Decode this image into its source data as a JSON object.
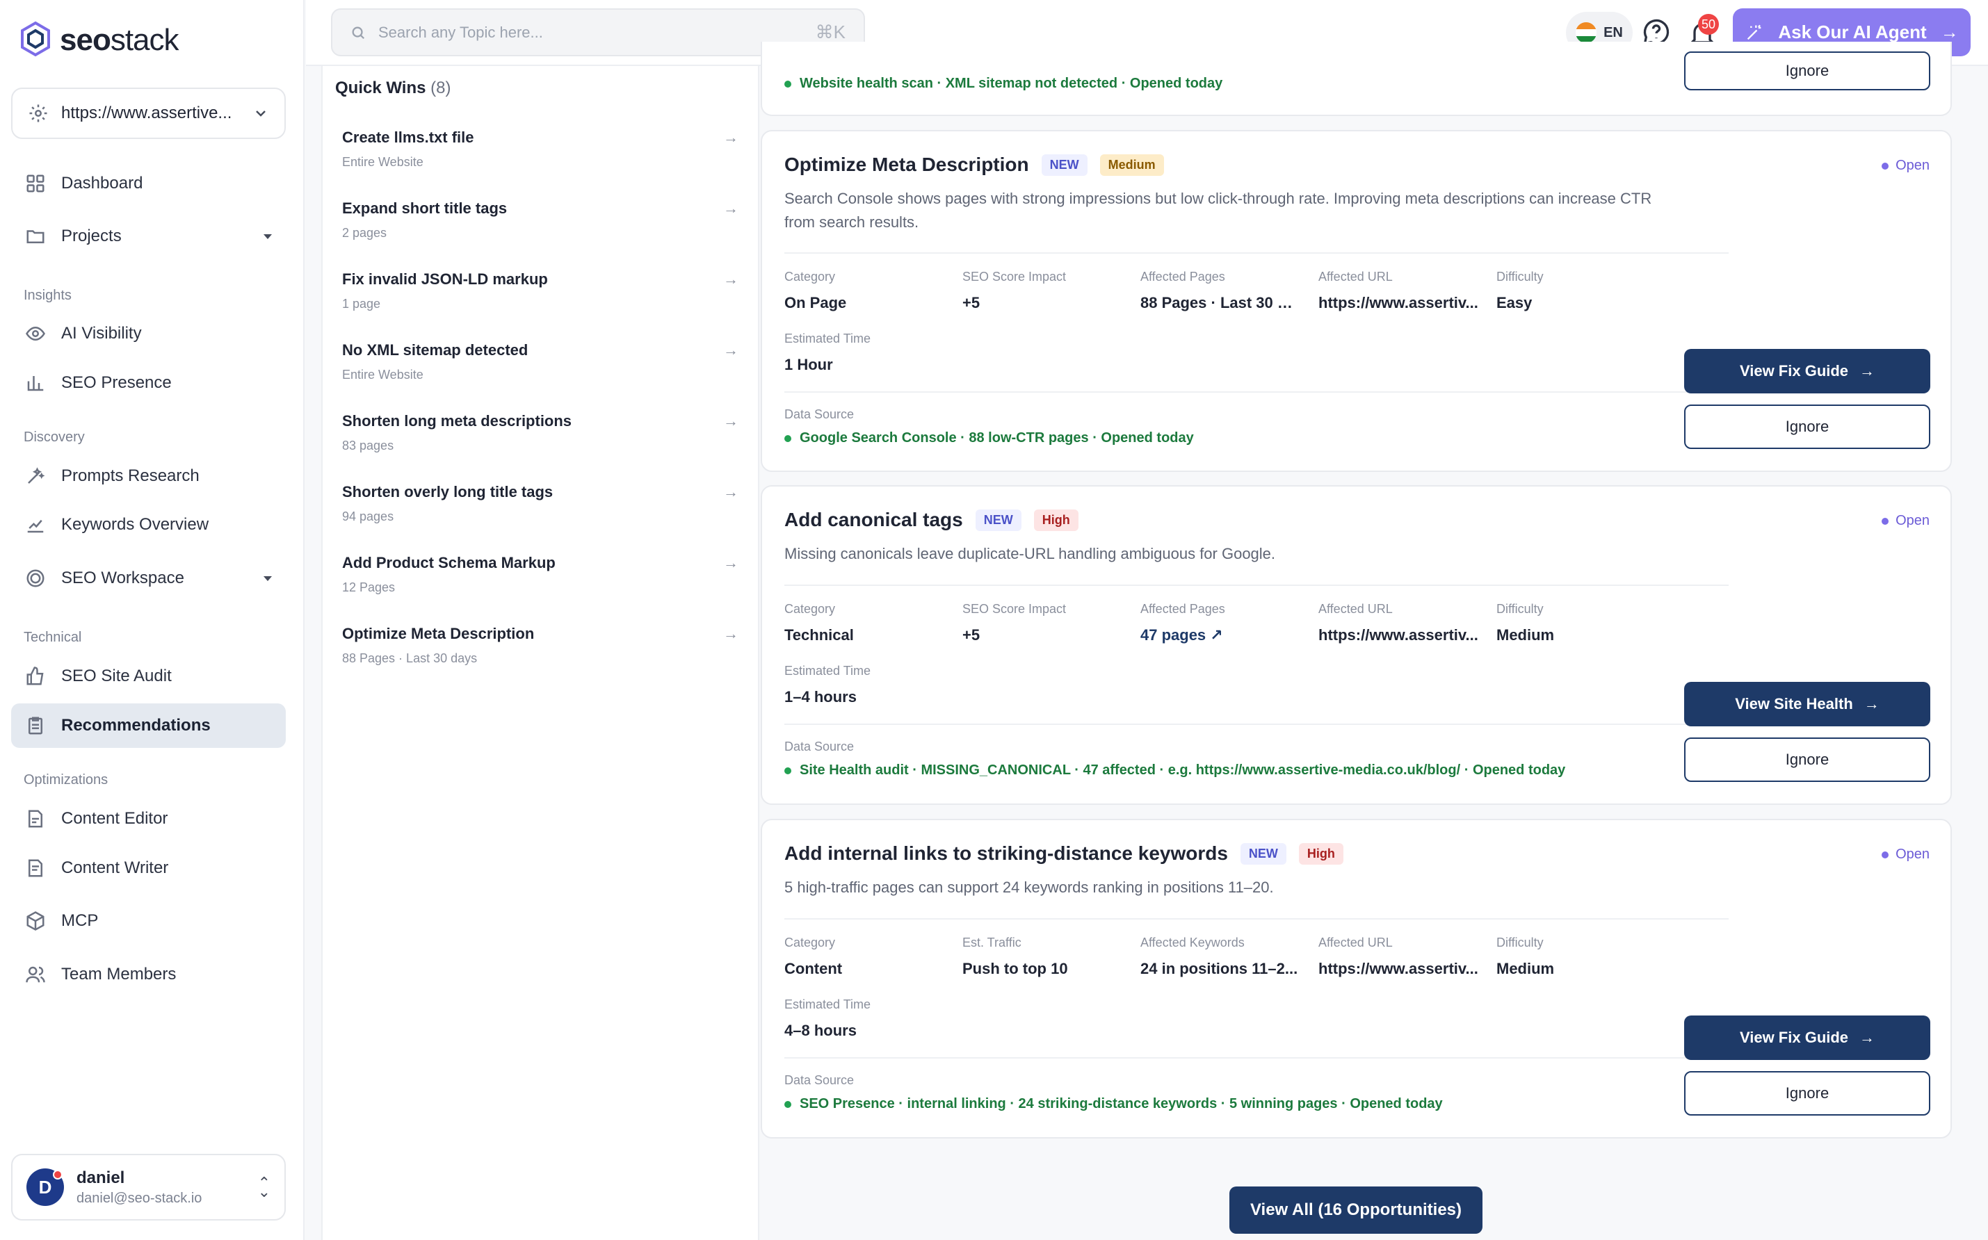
{
  "brand": {
    "name_bold": "seo",
    "name_light": "stack"
  },
  "site_selector": {
    "value": "https://www.assertive..."
  },
  "nav": {
    "dashboard": "Dashboard",
    "projects": "Projects",
    "insights_label": "Insights",
    "ai_visibility": "AI Visibility",
    "seo_presence": "SEO Presence",
    "discovery_label": "Discovery",
    "prompts_research": "Prompts Research",
    "keywords_overview": "Keywords Overview",
    "seo_workspace": "SEO Workspace",
    "technical_label": "Technical",
    "seo_site_audit": "SEO Site Audit",
    "recommendations": "Recommendations",
    "optimizations_label": "Optimizations",
    "content_editor": "Content Editor",
    "content_writer": "Content Writer",
    "mcp": "MCP",
    "team_members": "Team Members"
  },
  "user": {
    "initial": "D",
    "name": "daniel",
    "email": "daniel@seo-stack.io"
  },
  "topbar": {
    "search_placeholder": "Search any Topic here...",
    "search_shortcut": "⌘K",
    "language": "EN",
    "notifications": "50",
    "agent_button": "Ask Our AI Agent"
  },
  "quick_wins": {
    "title": "Quick Wins",
    "count": "(8)",
    "items": [
      {
        "title": "Create llms.txt file",
        "sub": "Entire Website"
      },
      {
        "title": "Expand short title tags",
        "sub": "2 pages"
      },
      {
        "title": "Fix invalid JSON-LD markup",
        "sub": "1 page"
      },
      {
        "title": "No XML sitemap detected",
        "sub": "Entire Website"
      },
      {
        "title": "Shorten long meta descriptions",
        "sub": "83 pages"
      },
      {
        "title": "Shorten overly long title tags",
        "sub": "94 pages"
      },
      {
        "title": "Add Product Schema Markup",
        "sub": "12 Pages"
      },
      {
        "title": "Optimize Meta Description",
        "sub": "88 Pages · Last 30 days"
      }
    ]
  },
  "cards": {
    "partial": {
      "data_source": "Website health scan · XML sitemap not detected · Opened today",
      "ignore": "Ignore"
    },
    "meta": {
      "title": "Optimize Meta Description",
      "new": "NEW",
      "severity": "Medium",
      "status": "Open",
      "desc": "Search Console shows pages with strong impressions but low click-through rate. Improving meta descriptions can increase CTR from search results.",
      "l1": "Category",
      "v1": "On Page",
      "l2": "SEO Score Impact",
      "v2": "+5",
      "l3": "Affected Pages",
      "v3": "88 Pages · Last 30 da...",
      "l4": "Affected URL",
      "v4": "https://www.assertiv...",
      "l5": "Difficulty",
      "v5": "Easy",
      "time_label": "Estimated Time",
      "time": "1 Hour",
      "ds_label": "Data Source",
      "ds": "Google Search Console · 88 low-CTR pages · Opened today",
      "primary": "View Fix Guide",
      "ignore": "Ignore"
    },
    "canonical": {
      "title": "Add canonical tags",
      "new": "NEW",
      "severity": "High",
      "status": "Open",
      "desc": "Missing canonicals leave duplicate-URL handling ambiguous for Google.",
      "l1": "Category",
      "v1": "Technical",
      "l2": "SEO Score Impact",
      "v2": "+5",
      "l3": "Affected Pages",
      "v3": "47 pages ↗",
      "l4": "Affected URL",
      "v4": "https://www.assertiv...",
      "l5": "Difficulty",
      "v5": "Medium",
      "time_label": "Estimated Time",
      "time": "1–4 hours",
      "ds_label": "Data Source",
      "ds": "Site Health audit · MISSING_CANONICAL · 47 affected · e.g. https://www.assertive-media.co.uk/blog/ · Opened today",
      "primary": "View Site Health",
      "ignore": "Ignore"
    },
    "links": {
      "title": "Add internal links to striking-distance keywords",
      "new": "NEW",
      "severity": "High",
      "status": "Open",
      "desc": "5 high-traffic pages can support 24 keywords ranking in positions 11–20.",
      "l1": "Category",
      "v1": "Content",
      "l2": "Est. Traffic",
      "v2": "Push to top 10",
      "l3": "Affected Keywords",
      "v3": "24 in positions 11–2...",
      "l4": "Affected URL",
      "v4": "https://www.assertiv...",
      "l5": "Difficulty",
      "v5": "Medium",
      "time_label": "Estimated Time",
      "time": "4–8 hours",
      "ds_label": "Data Source",
      "ds": "SEO Presence · internal linking · 24 striking-distance keywords · 5 winning pages · Opened today",
      "primary": "View Fix Guide",
      "ignore": "Ignore"
    }
  },
  "view_all": "View All (16 Opportunities)"
}
